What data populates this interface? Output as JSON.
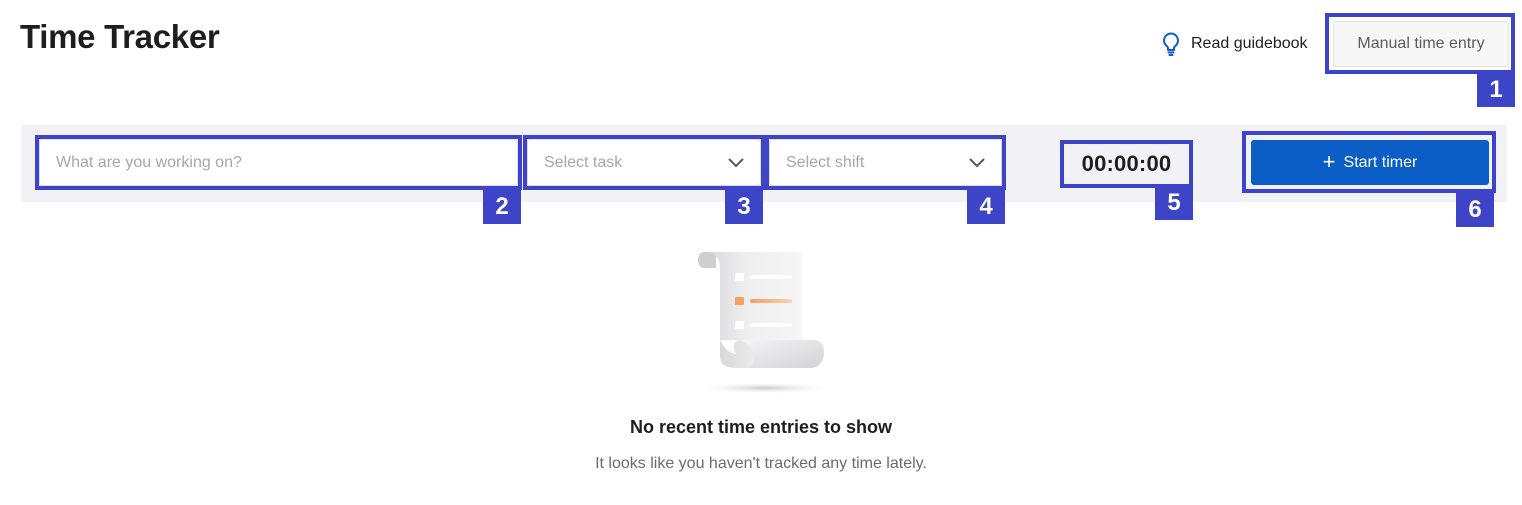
{
  "header": {
    "title": "Time Tracker",
    "guidebook_label": "Read guidebook",
    "guidebook_icon": "lightbulb-icon",
    "manual_entry_label": "Manual time entry"
  },
  "tracker_bar": {
    "description_placeholder": "What are you working on?",
    "task_placeholder": "Select task",
    "shift_placeholder": "Select shift",
    "timer_value": "00:00:00",
    "start_button_label": "Start timer",
    "start_button_icon": "plus-icon"
  },
  "annotations": {
    "badges": [
      "1",
      "2",
      "3",
      "4",
      "5",
      "6"
    ],
    "color": "#3d44c8"
  },
  "empty_state": {
    "illustration": "scroll-list-icon",
    "title": "No recent time entries to show",
    "subtitle": "It looks like you haven't tracked any time lately."
  },
  "colors": {
    "primary": "#0a5ec5",
    "bar_background": "#f2f2f6",
    "accent_orange": "#f5a05a"
  }
}
